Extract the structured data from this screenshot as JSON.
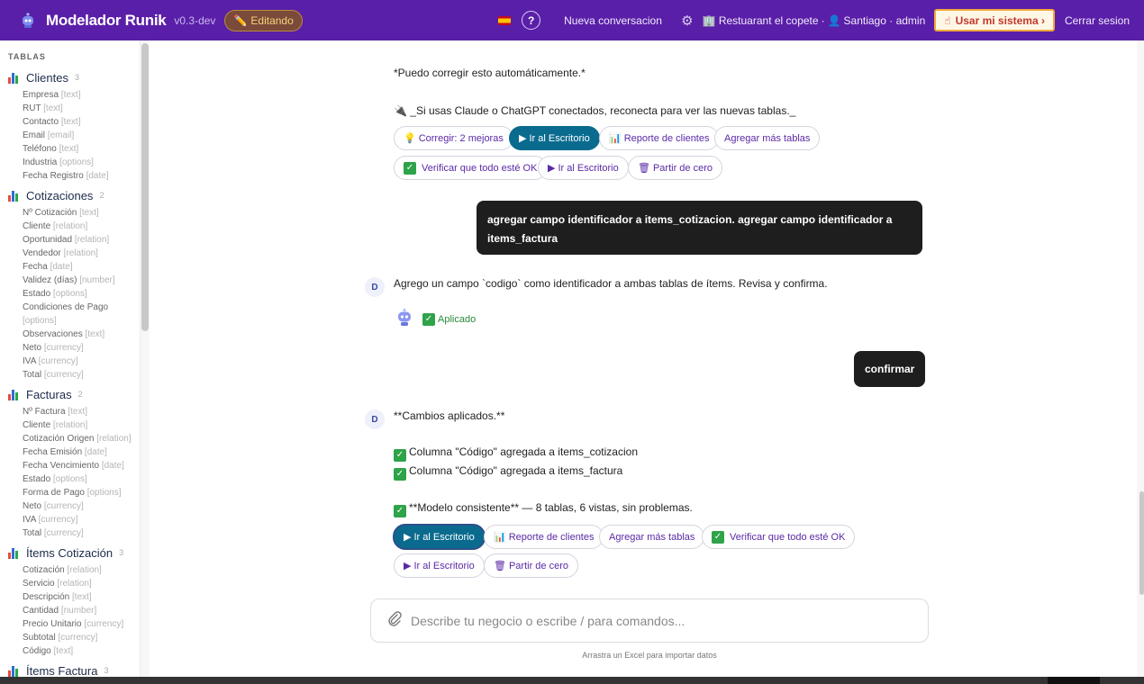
{
  "header": {
    "brand": "Modelador Runik",
    "version": "v0.3-dev",
    "edit_badge": "Editando",
    "help": "?",
    "new_conversation": "Nueva conversacion",
    "business": "Restuarant el copete",
    "user": "Santiago · admin",
    "use_system": "Usar mi sistema ›",
    "logout": "Cerrar sesion"
  },
  "sidebar": {
    "title": "TABLAS",
    "tables": [
      {
        "name": "Clientes",
        "count": "3",
        "fields": [
          {
            "name": "Empresa",
            "type": "[text]"
          },
          {
            "name": "RUT",
            "type": "[text]"
          },
          {
            "name": "Contacto",
            "type": "[text]"
          },
          {
            "name": "Email",
            "type": "[email]"
          },
          {
            "name": "Teléfono",
            "type": "[text]"
          },
          {
            "name": "Industria",
            "type": "[options]"
          },
          {
            "name": "Fecha Registro",
            "type": "[date]"
          }
        ]
      },
      {
        "name": "Cotizaciones",
        "count": "2",
        "fields": [
          {
            "name": "Nº Cotización",
            "type": "[text]"
          },
          {
            "name": "Cliente",
            "type": "[relation]"
          },
          {
            "name": "Oportunidad",
            "type": "[relation]"
          },
          {
            "name": "Vendedor",
            "type": "[relation]"
          },
          {
            "name": "Fecha",
            "type": "[date]"
          },
          {
            "name": "Validez (días)",
            "type": "[number]"
          },
          {
            "name": "Estado",
            "type": "[options]"
          },
          {
            "name": "Condiciones de Pago",
            "type": "[options]"
          },
          {
            "name": "Observaciones",
            "type": "[text]"
          },
          {
            "name": "Neto",
            "type": "[currency]"
          },
          {
            "name": "IVA",
            "type": "[currency]"
          },
          {
            "name": "Total",
            "type": "[currency]"
          }
        ]
      },
      {
        "name": "Facturas",
        "count": "2",
        "fields": [
          {
            "name": "Nº Factura",
            "type": "[text]"
          },
          {
            "name": "Cliente",
            "type": "[relation]"
          },
          {
            "name": "Cotización Origen",
            "type": "[relation]"
          },
          {
            "name": "Fecha Emisión",
            "type": "[date]"
          },
          {
            "name": "Fecha Vencimiento",
            "type": "[date]"
          },
          {
            "name": "Estado",
            "type": "[options]"
          },
          {
            "name": "Forma de Pago",
            "type": "[options]"
          },
          {
            "name": "Neto",
            "type": "[currency]"
          },
          {
            "name": "IVA",
            "type": "[currency]"
          },
          {
            "name": "Total",
            "type": "[currency]"
          }
        ]
      },
      {
        "name": "Ítems Cotización",
        "count": "3",
        "fields": [
          {
            "name": "Cotización",
            "type": "[relation]"
          },
          {
            "name": "Servicio",
            "type": "[relation]"
          },
          {
            "name": "Descripción",
            "type": "[text]"
          },
          {
            "name": "Cantidad",
            "type": "[number]"
          },
          {
            "name": "Precio Unitario",
            "type": "[currency]"
          },
          {
            "name": "Subtotal",
            "type": "[currency]"
          },
          {
            "name": "Código",
            "type": "[text]"
          }
        ]
      },
      {
        "name": "Ítems Factura",
        "count": "3",
        "fields": []
      }
    ]
  },
  "chat": {
    "fix_note": "*Puedo corregir esto automáticamente.*",
    "reconnect_note": "_Si usas Claude o ChatGPT conectados, reconecta para ver las nuevas tablas._",
    "chips1": [
      "Corregir: 2 mejoras",
      "Ir al Escritorio",
      "Reporte de clientes",
      "Agregar más tablas",
      "Verificar que todo esté OK",
      "Ir al Escritorio",
      "Partir de cero"
    ],
    "user_msg1": "agregar campo identificador a items_cotizacion. agregar campo identificador a items_factura",
    "avatar": "D",
    "assistant_msg1": "Agrego un campo `codigo` como identificador a ambas tablas de ítems. Revisa y confirma.",
    "applied": "Aplicado",
    "user_msg2": "confirmar",
    "assistant_msg2_title": "**Cambios aplicados.**",
    "assistant_msg2_lines": [
      "Columna \"Código\" agregada a items_cotizacion",
      "Columna \"Código\" agregada a items_factura"
    ],
    "assistant_msg2_summary": "**Modelo consistente** — 8 tablas, 6 vistas, sin problemas.",
    "chips2": [
      "Ir al Escritorio",
      "Reporte de clientes",
      "Agregar más tablas",
      "Verificar que todo esté OK",
      "Ir al Escritorio",
      "Partir de cero"
    ]
  },
  "composer": {
    "placeholder": "Describe tu negocio o escribe / para comandos...",
    "hint": "Arrastra un Excel para importar datos"
  }
}
